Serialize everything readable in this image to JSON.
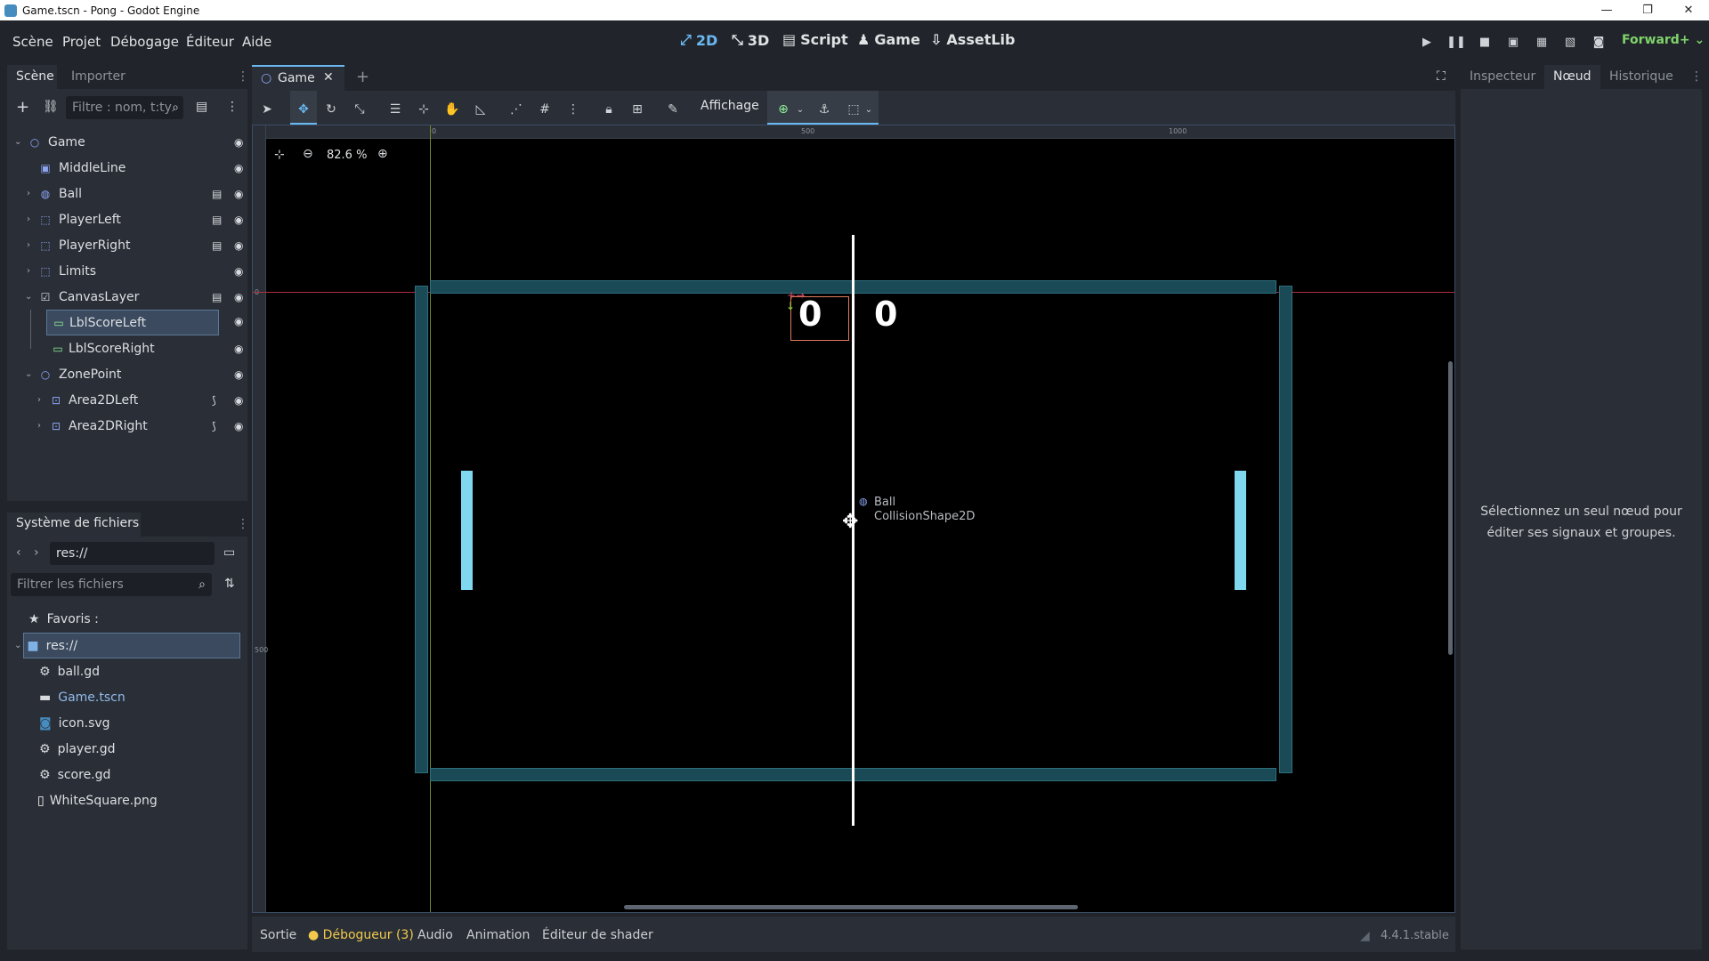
{
  "window": {
    "title": "Game.tscn - Pong - Godot Engine",
    "controls": [
      "—",
      "❐",
      "✕"
    ]
  },
  "menubar": {
    "menus": [
      "Scène",
      "Projet",
      "Débogage",
      "Éditeur",
      "Aide"
    ],
    "workspaces": [
      "2D",
      "3D",
      "Script",
      "Game",
      "AssetLib"
    ],
    "renderer": "Forward+"
  },
  "scene_dock": {
    "tabs": [
      "Scène",
      "Importer"
    ],
    "filter_placeholder": "Filtre : nom, t:ty",
    "nodes": [
      {
        "label": "Game",
        "icon": "node2d-icon"
      },
      {
        "label": "MiddleLine",
        "icon": "sprite-icon"
      },
      {
        "label": "Ball",
        "icon": "rigidbody-icon"
      },
      {
        "label": "PlayerLeft",
        "icon": "area-icon"
      },
      {
        "label": "PlayerRight",
        "icon": "area-icon"
      },
      {
        "label": "Limits",
        "icon": "area-icon"
      },
      {
        "label": "CanvasLayer",
        "icon": "canvaslayer-icon"
      },
      {
        "label": "LblScoreLeft",
        "icon": "label-icon"
      },
      {
        "label": "LblScoreRight",
        "icon": "label-icon"
      },
      {
        "label": "ZonePoint",
        "icon": "node2d-icon"
      },
      {
        "label": "Area2DLeft",
        "icon": "area2d-icon"
      },
      {
        "label": "Area2DRight",
        "icon": "area2d-icon"
      }
    ]
  },
  "filesystem_dock": {
    "title": "Système de fichiers",
    "path": "res://",
    "filter_placeholder": "Filtrer les fichiers",
    "favorites_label": "Favoris :",
    "root": "res://",
    "files": [
      "ball.gd",
      "Game.tscn",
      "icon.svg",
      "player.gd",
      "score.gd",
      "WhiteSquare.png"
    ]
  },
  "editor": {
    "scene_tab": "Game",
    "view_menu": "Affichage",
    "zoom": "82.6 %",
    "ruler_labels": {
      "h": [
        "0",
        "500",
        "1000"
      ],
      "v": [
        "0",
        "500"
      ]
    },
    "score_left": "0",
    "score_right": "0",
    "ball_label": "Ball",
    "collision_label": "CollisionShape2D"
  },
  "inspector_dock": {
    "tabs": [
      "Inspecteur",
      "Nœud",
      "Historique"
    ],
    "message": "Sélectionnez un seul nœud pour éditer ses signaux et groupes."
  },
  "bottom_panel": {
    "tabs": [
      "Sortie",
      "Débogueur (3)",
      "Audio",
      "Animation",
      "Éditeur de shader"
    ],
    "version": "4.4.1.stable"
  },
  "colors": {
    "accent": "#6ab8f2",
    "paddle": "#7fd8f0",
    "wall": "#1a4a55",
    "debugger_dot": "#f2c94c"
  }
}
